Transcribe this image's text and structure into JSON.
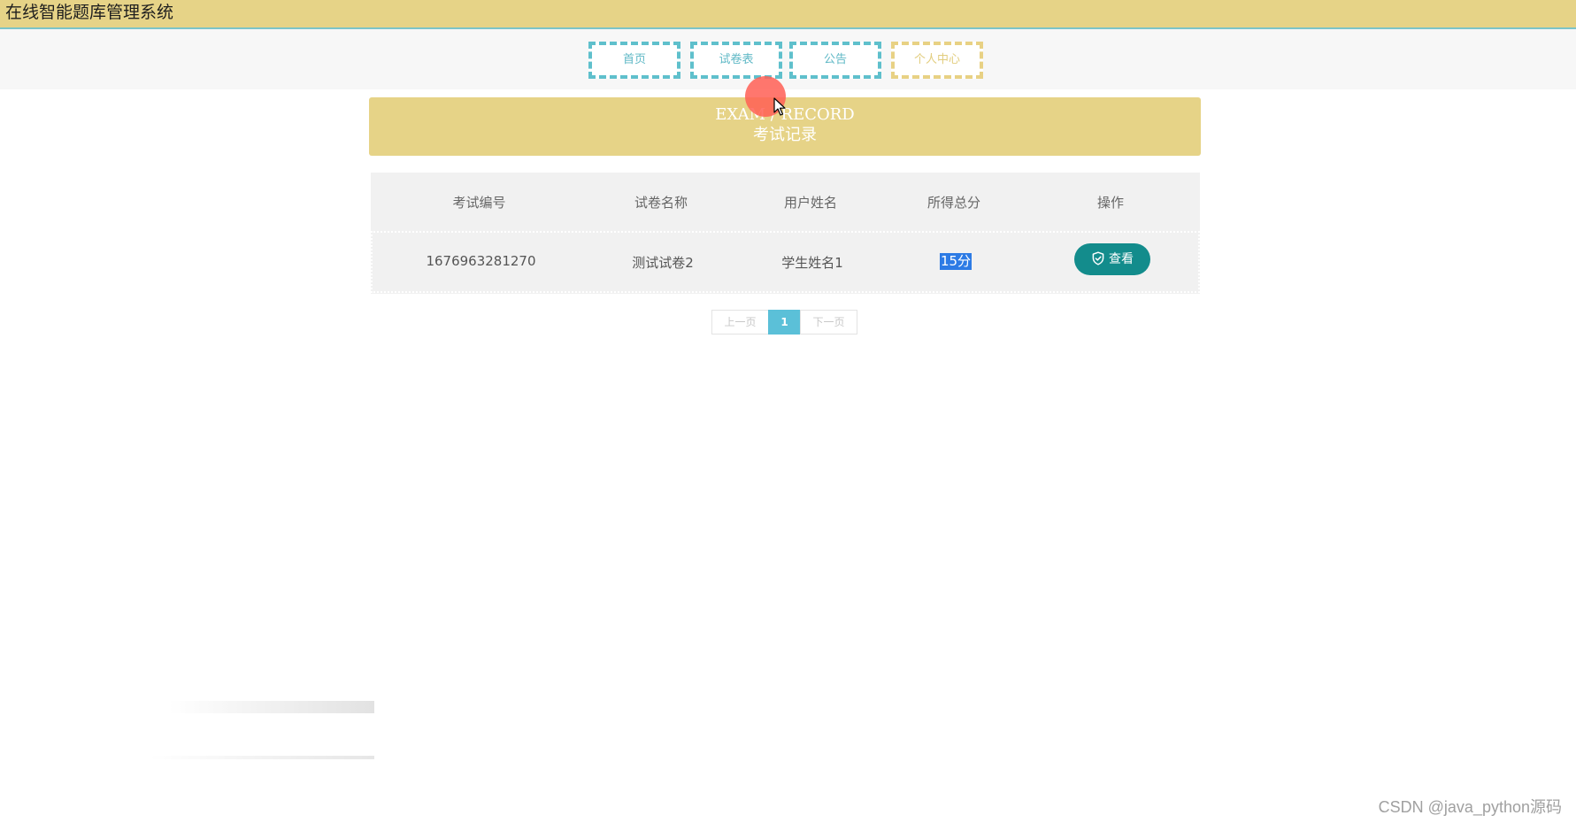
{
  "app": {
    "title": "在线智能题库管理系统"
  },
  "nav": {
    "items": [
      {
        "label": "首页"
      },
      {
        "label": "试卷表"
      },
      {
        "label": "公告"
      },
      {
        "label": "个人中心"
      }
    ],
    "active_index": 3
  },
  "banner": {
    "title_en": "EXAM / RECORD",
    "title_cn": "考试记录"
  },
  "table": {
    "columns": [
      "考试编号",
      "试卷名称",
      "用户姓名",
      "所得总分",
      "操作"
    ],
    "rows": [
      {
        "exam_id": "1676963281270",
        "paper_name": "测试试卷2",
        "user_name": "学生姓名1",
        "score": "15分",
        "action_label": "查看"
      }
    ]
  },
  "pagination": {
    "prev_label": "上一页",
    "current_page": "1",
    "next_label": "下一页"
  },
  "watermark": "CSDN @java_python源码",
  "colors": {
    "header_bg": "#e6d387",
    "accent": "#5fc0cc",
    "view_button": "#138c8c",
    "page_active": "#5bc0d8"
  }
}
